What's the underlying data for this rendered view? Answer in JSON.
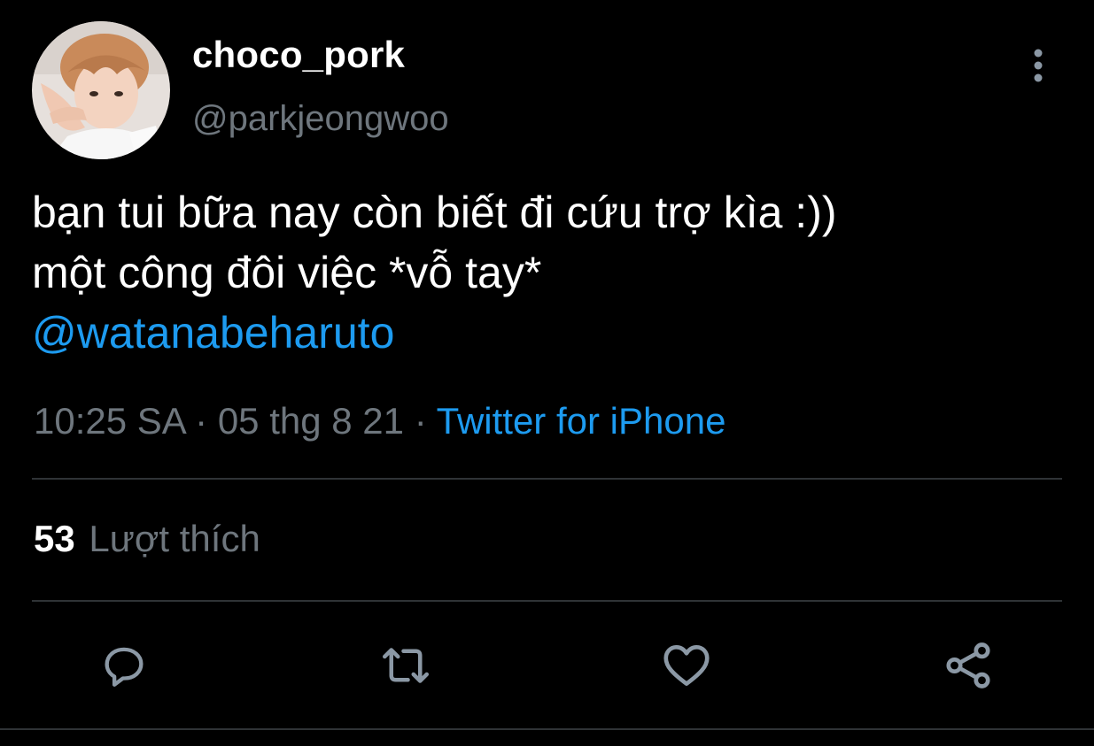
{
  "tweet": {
    "author": {
      "display_name": "choco_pork",
      "handle": "@parkjeongwoo",
      "avatar_icon": "profile-photo"
    },
    "text_lines": [
      "bạn tui bữa nay còn biết đi cứu trợ kìa :))",
      "một công đôi việc *vỗ tay*"
    ],
    "mention": "@watanabeharuto",
    "time": "10:25 SA",
    "separator": "·",
    "date": "05 thg 8 21",
    "source": "Twitter for iPhone",
    "likes": {
      "count": "53",
      "label": "Lượt thích"
    }
  },
  "actions": {
    "reply_icon": "reply-icon",
    "retweet_icon": "retweet-icon",
    "like_icon": "heart-icon",
    "share_icon": "share-icon",
    "more_icon": "more-vertical-icon"
  },
  "colors": {
    "background": "#000000",
    "text": "#ffffff",
    "muted": "#6e767d",
    "link": "#1d9bf0",
    "divider": "#2f3336",
    "icon": "#8b98a5"
  }
}
